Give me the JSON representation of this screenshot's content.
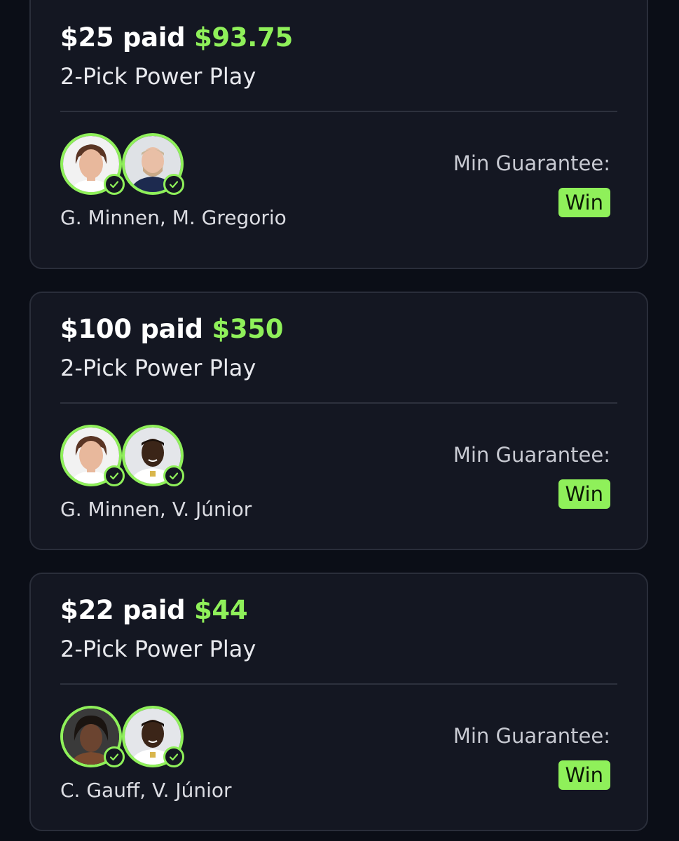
{
  "entries": [
    {
      "paid": "$25 paid",
      "payout": "$93.75",
      "play_type": "2-Pick Power Play",
      "players": "G. Minnen, M. Gregorio",
      "min_guarantee_label": "Min Guarantee:",
      "result": "Win"
    },
    {
      "paid": "$100 paid",
      "payout": "$350",
      "play_type": "2-Pick Power Play",
      "players": "G. Minnen, V. Júnior",
      "min_guarantee_label": "Min Guarantee:",
      "result": "Win"
    },
    {
      "paid": "$22 paid",
      "payout": "$44",
      "play_type": "2-Pick Power Play",
      "players": "C. Gauff, V. Júnior",
      "min_guarantee_label": "Min Guarantee:",
      "result": "Win"
    }
  ],
  "colors": {
    "background": "#0b0e17",
    "card": "#141722",
    "accent_green": "#8ff05a"
  },
  "icons": {
    "pick_status": "check-circle-icon",
    "player": "player-avatar"
  }
}
